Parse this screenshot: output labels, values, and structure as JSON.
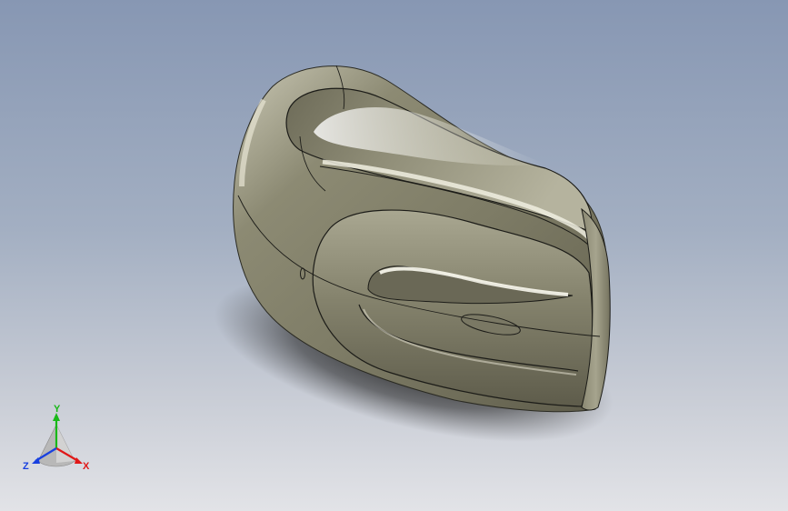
{
  "viewport": {
    "background_top": "#8797b3",
    "background_bottom": "#e2e3e7"
  },
  "model": {
    "body_color": "#8a876f",
    "highlight_color": "#f4f3e6",
    "edge_color": "#1c1c18"
  },
  "triad": {
    "x_label": "X",
    "y_label": "Y",
    "z_label": "Z",
    "x_color": "#e01818",
    "y_color": "#18b818",
    "z_color": "#1840e0"
  }
}
